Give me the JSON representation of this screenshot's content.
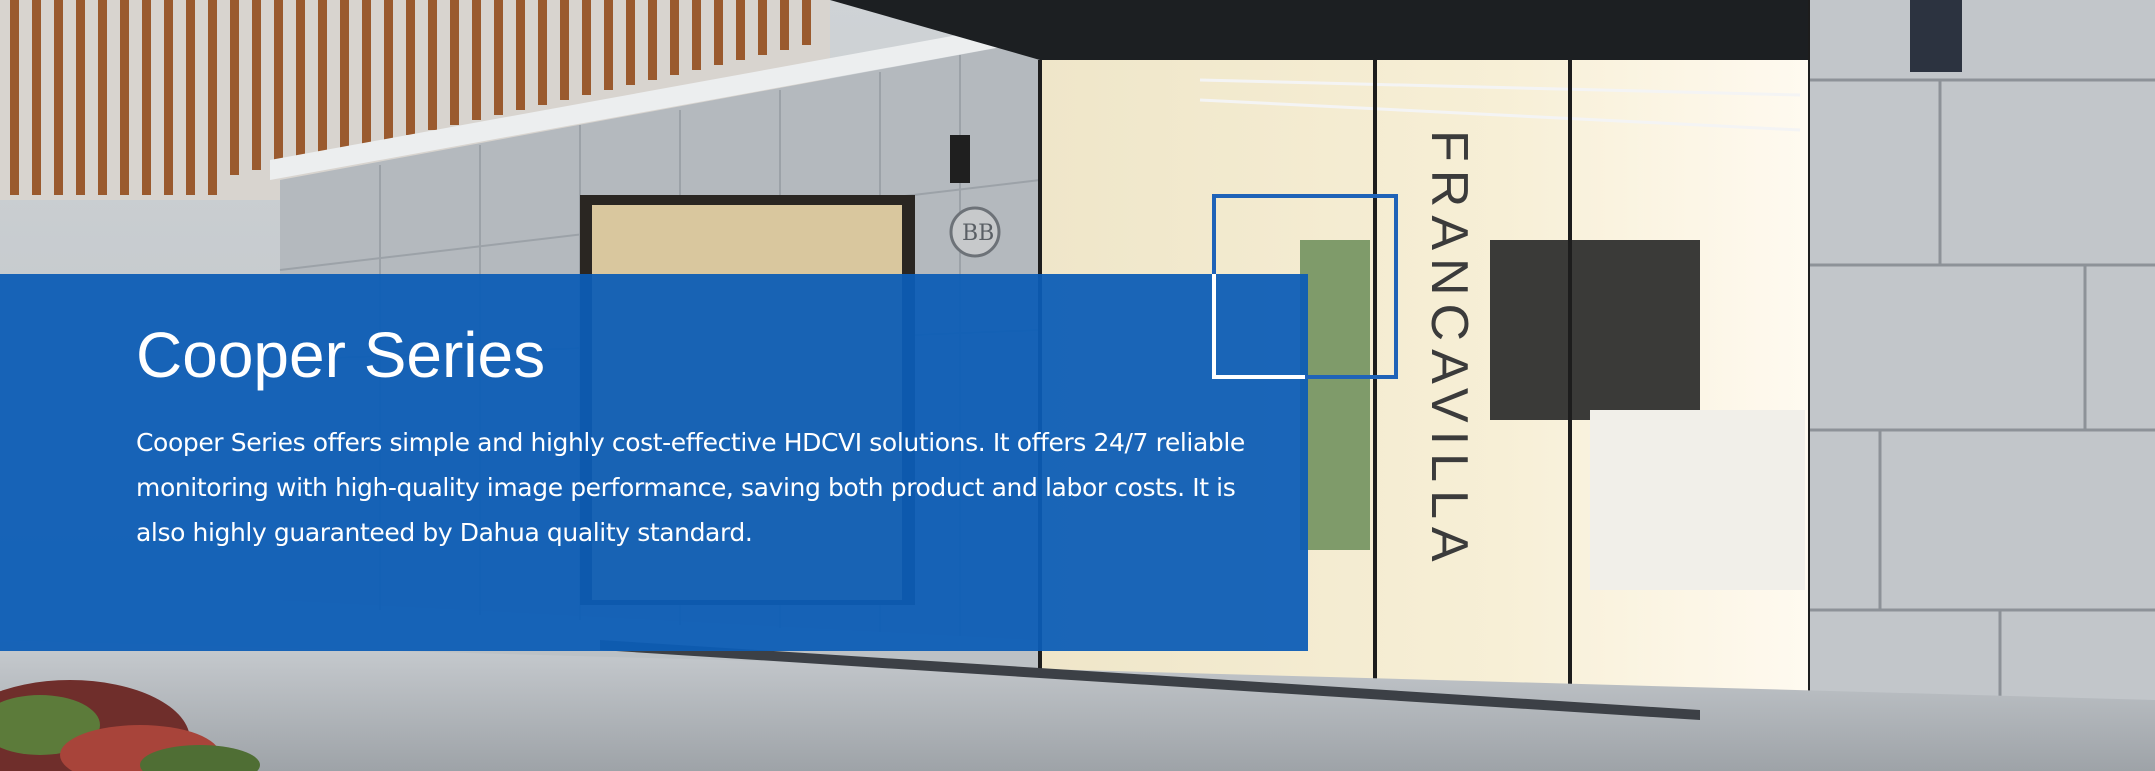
{
  "banner": {
    "title": "Cooper Series",
    "description": "Cooper Series offers simple and highly cost-effective HDCVI solutions. It offers 24/7 reliable monitoring with high-quality image performance, saving both product and labor costs. It is also highly guaranteed by Dahua quality standard.",
    "storefront_sign": "FRANCAVILLA",
    "store_logo": "BB",
    "panel_color": "#0c5cb6",
    "frame_color": "#1f63b8"
  }
}
